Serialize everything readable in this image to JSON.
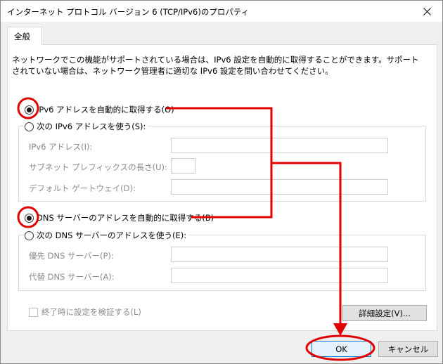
{
  "window": {
    "title": "インターネット プロトコル バージョン 6 (TCP/IPv6)のプロパティ"
  },
  "tab": {
    "label": "全般"
  },
  "description": "ネットワークでこの機能がサポートされている場合は、IPv6 設定を自動的に取得することができます。サポートされていない場合は、ネットワーク管理者に適切な IPv6 設定を問い合わせてください。",
  "ip_section": {
    "auto_label": "IPv6 アドレスを自動的に取得する(O)",
    "auto_selected": true,
    "manual_label": "次の IPv6 アドレスを使う(S):",
    "fields": [
      {
        "label": "IPv6 アドレス(I):",
        "value": ""
      },
      {
        "label": "サブネット プレフィックスの長さ(U):",
        "value": ""
      },
      {
        "label": "デフォルト ゲートウェイ(D):",
        "value": ""
      }
    ]
  },
  "dns_section": {
    "auto_label": "DNS サーバーのアドレスを自動的に取得する(B)",
    "auto_selected": true,
    "manual_label": "次の DNS サーバーのアドレスを使う(E):",
    "fields": [
      {
        "label": "優先 DNS サーバー(P):",
        "value": ""
      },
      {
        "label": "代替 DNS サーバー(A):",
        "value": ""
      }
    ]
  },
  "validate_label": "終了時に設定を検証する(L)",
  "buttons": {
    "advanced": "詳細設定(V)...",
    "ok": "OK",
    "cancel": "キャンセル"
  },
  "annotation_color": "#e00000"
}
